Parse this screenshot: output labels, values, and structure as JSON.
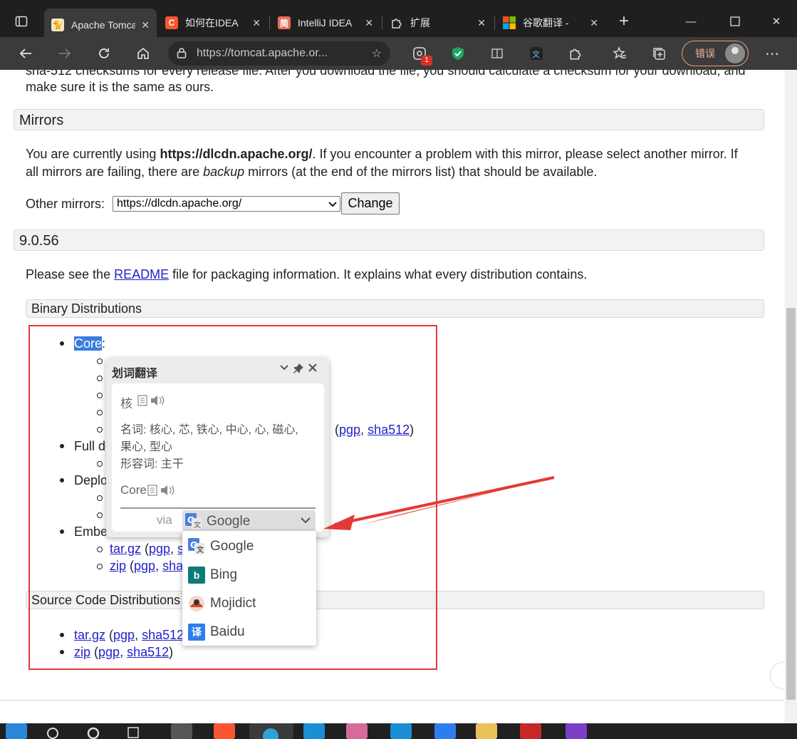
{
  "browser": {
    "tabs": [
      {
        "title": "Apache Tomcat",
        "icon": "tomcat-icon"
      },
      {
        "title": "如何在IDEA",
        "icon": "csdn-icon"
      },
      {
        "title": "IntelliJ IDEA",
        "icon": "jianshu-icon"
      },
      {
        "title": "扩展",
        "icon": "extensions-icon"
      },
      {
        "title": "谷歌翻译 -",
        "icon": "microsoft-icon"
      }
    ],
    "url": "https://tomcat.apache.or...",
    "extension_badge": "1",
    "error_label": "错误"
  },
  "page": {
    "intro_partial": "sha-512 checksums for every release file. After you download the file, you should calculate a checksum for your download, and",
    "intro_line2": "make sure it is the same as ours.",
    "mirrors": {
      "heading": "Mirrors",
      "text_before": "You are currently using ",
      "current_mirror": "https://dlcdn.apache.org/",
      "text_after": ". If you encounter a problem with this mirror, please select another mirror. If",
      "line2_before": "all mirrors are failing, there are ",
      "backup_word": "backup",
      "line2_after": " mirrors (at the end of the mirrors list) that should be available.",
      "other_label": "Other mirrors:",
      "select_value": "https://dlcdn.apache.org/",
      "change_button": "Change"
    },
    "version": {
      "heading": "9.0.56",
      "readme_before": "Please see the ",
      "readme_link": "README",
      "readme_after": " file for packaging information. It explains what every distribution contains."
    },
    "binary": {
      "heading": "Binary Distributions",
      "core": "Core",
      "core_colon": ":",
      "core_last_links": {
        "open": "(",
        "pgp": "pgp",
        "sep": ", ",
        "sha": "sha512",
        "close": ")"
      },
      "full_doc": "Full do",
      "deployer": "Deplo",
      "embedded": "Embe",
      "embedded_items": [
        {
          "name": "tar.gz",
          "open": " (",
          "pgp": "pgp",
          "sep": ", ",
          "sha": "s"
        },
        {
          "name": "zip",
          "open": " (",
          "pgp": "pgp",
          "sep": ", ",
          "sha": "sha"
        }
      ]
    },
    "source": {
      "heading": "Source Code Distributions",
      "items": [
        {
          "name": "tar.gz",
          "open": " (",
          "pgp": "pgp",
          "sep": ", ",
          "sha": "sha512",
          "close": ""
        },
        {
          "name": "zip",
          "open": " (",
          "pgp": "pgp",
          "sep": ", ",
          "sha": "sha512",
          "close": ")"
        }
      ]
    }
  },
  "translator": {
    "title": "划词翻译",
    "word_cn": "核",
    "meaning_line1": "名词: 核心, 芯, 铁心, 中心, 心, 磁心,",
    "meaning_line2": "果心, 型心",
    "meaning_line3": "形容词: 主干",
    "word_en": "Core",
    "via_label": "via",
    "selected_engine": "Google",
    "engines": [
      {
        "name": "Google",
        "icon": "google-translate-icon",
        "color": "#4a7fe0"
      },
      {
        "name": "Bing",
        "icon": "bing-icon",
        "color": "#0f7b79"
      },
      {
        "name": "Mojidict",
        "icon": "mojidict-icon",
        "color": "#d9472b"
      },
      {
        "name": "Baidu",
        "icon": "baidu-translate-icon",
        "color": "#2e7df0"
      }
    ]
  },
  "colors": {
    "annotation_red": "#e53935",
    "link": "#2222cc",
    "highlight": "#3a7be0"
  }
}
